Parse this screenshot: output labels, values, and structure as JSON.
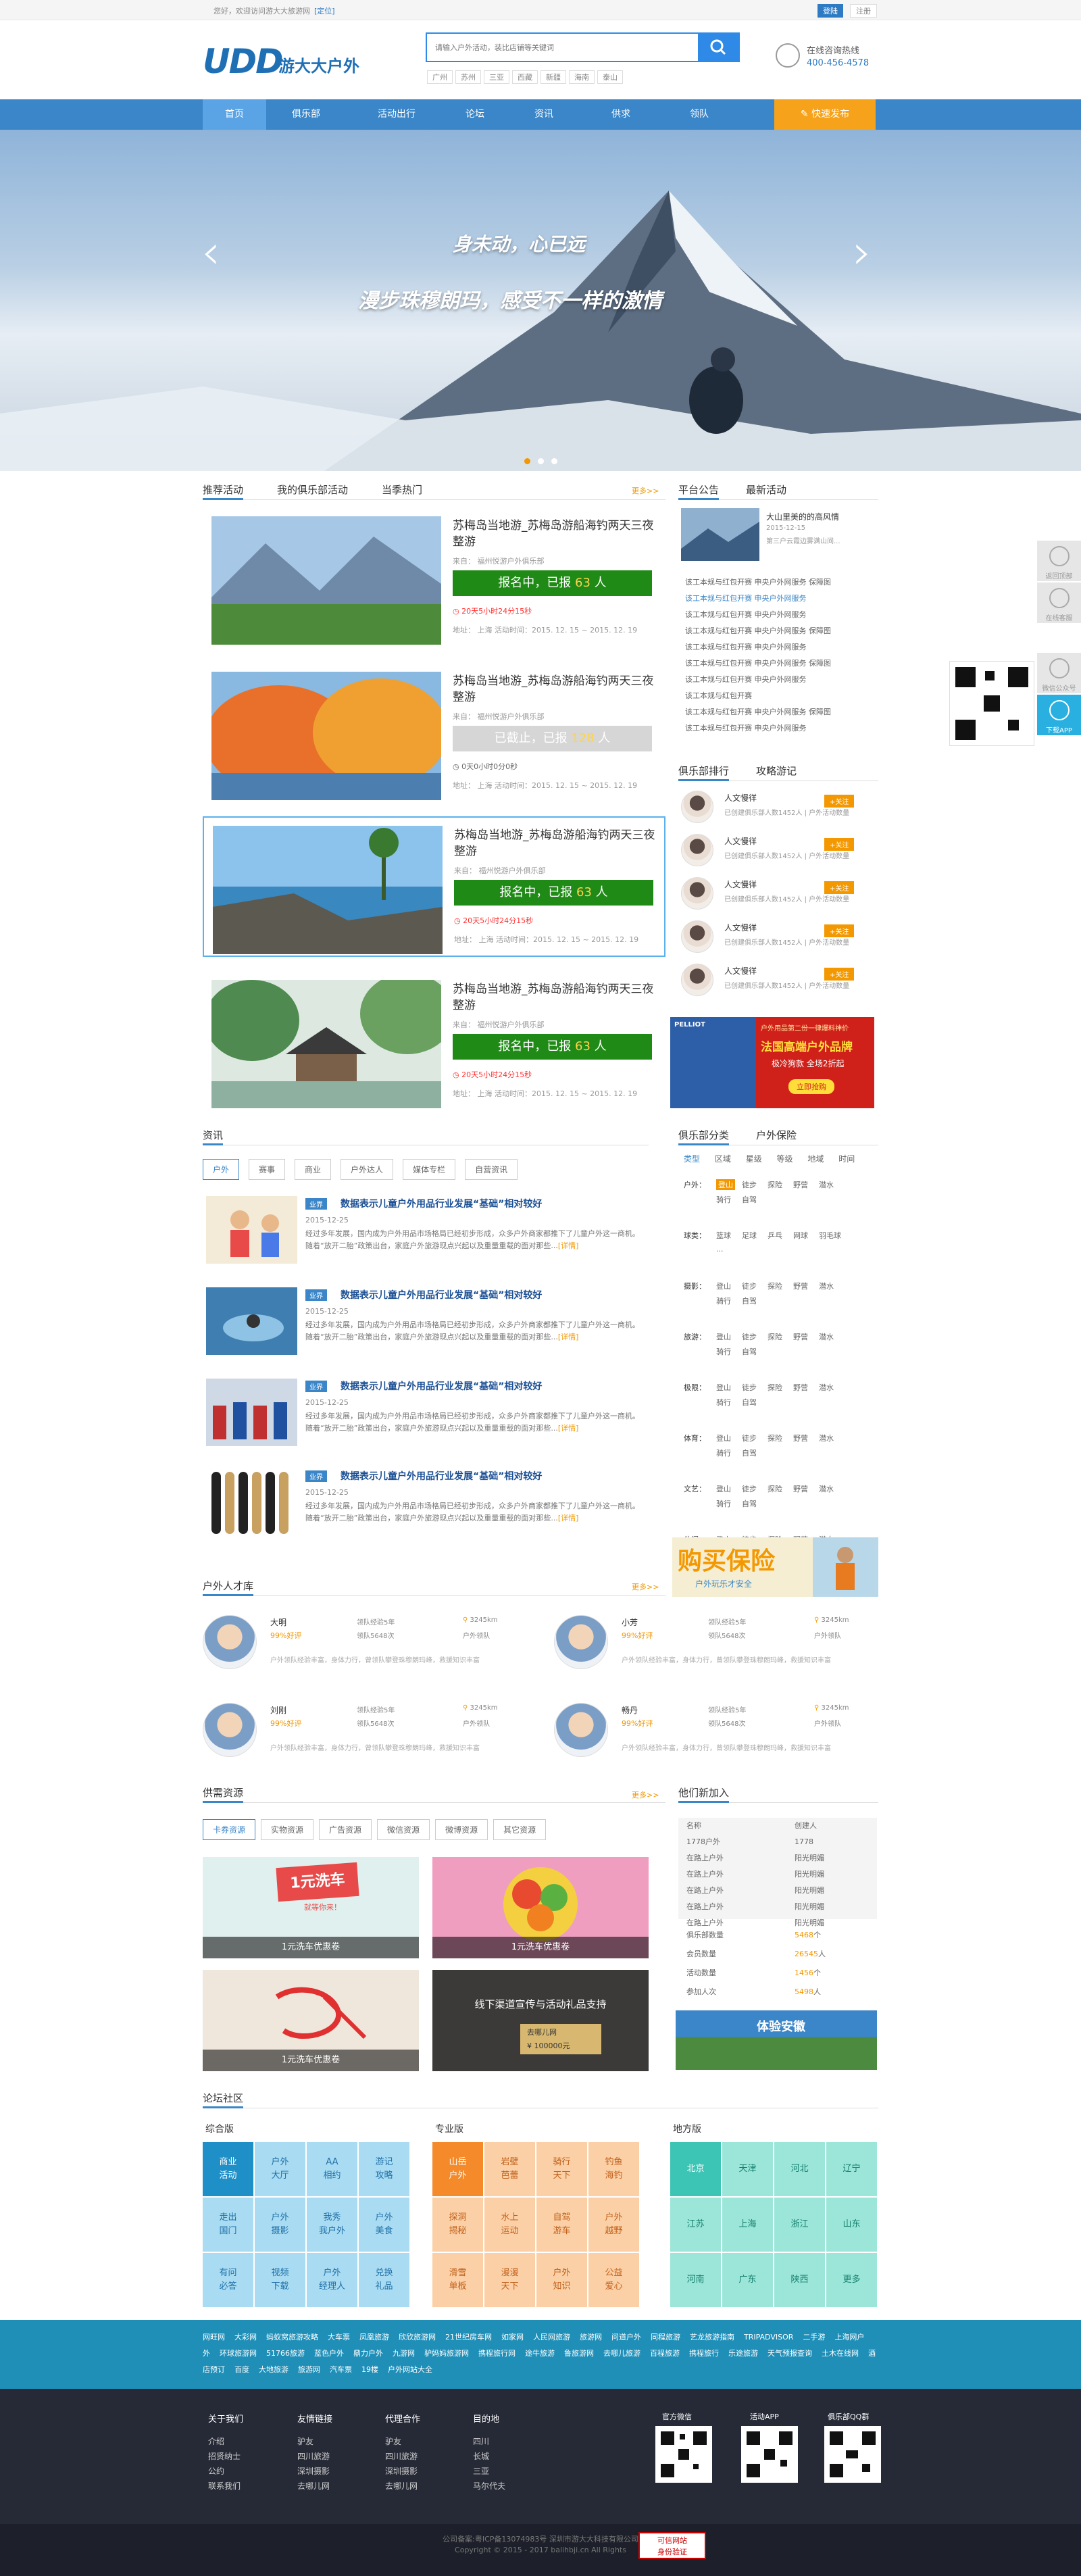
{
  "topbar": {
    "welcome": "您好，欢迎访问游大大旅游网",
    "city": "[定位]",
    "login": "登陆",
    "register": "注册"
  },
  "header": {
    "logo_mark": "UDD",
    "logo_cn": "游大大户外",
    "search_placeholder": "请输入户外活动，装比店铺等关键词",
    "hot": [
      "广州",
      "苏州",
      "三亚",
      "西藏",
      "新疆",
      "海南",
      "泰山"
    ],
    "phone_label": "在线咨询热线",
    "phone": "400-456-4578"
  },
  "nav": {
    "items": [
      "首页",
      "俱乐部",
      "活动出行",
      "论坛",
      "资讯",
      "供求",
      "领队"
    ],
    "fast": "快速发布"
  },
  "banner": {
    "line1": "身未动，心已远",
    "line2": "漫步珠穆朗玛，感受不一样的激情"
  },
  "activities": {
    "tabs": [
      "推荐活动",
      "我的俱乐部活动",
      "当季热门"
    ],
    "more": "更多>>",
    "items": [
      {
        "title": "苏梅岛当地游_苏梅岛游船海钓两天三夜整游",
        "meta": "来自：  福州悦游户外俱乐部",
        "status": "报名中，已报 63 人",
        "time": "20天5小时24分15秒",
        "addr": "地址：    上海         活动时间：2015. 12. 15 ~ 2015. 12. 19"
      },
      {
        "title": "苏梅岛当地游_苏梅岛游船海钓两天三夜整游",
        "meta": "来自：  福州悦游户外俱乐部",
        "status": "已截止，已报 128 人",
        "time": "0天0小时0分0秒",
        "addr": "地址：    上海         活动时间：2015. 12. 15 ~ 2015. 12. 19"
      },
      {
        "title": "苏梅岛当地游_苏梅岛游船海钓两天三夜整游",
        "meta": "来自：  福州悦游户外俱乐部",
        "status": "报名中，已报 63 人",
        "time": "20天5小时24分15秒",
        "addr": "地址：    上海         活动时间：2015. 12. 15 ~ 2015. 12. 19"
      },
      {
        "title": "苏梅岛当地游_苏梅岛游船海钓两天三夜整游",
        "meta": "来自：  福州悦游户外俱乐部",
        "status": "报名中，已报 63 人",
        "time": "20天5小时24分15秒",
        "addr": "地址：    上海         活动时间：2015. 12. 15 ~ 2015. 12. 19"
      }
    ]
  },
  "notice": {
    "tabs": [
      "平台公告",
      "最新活动"
    ],
    "top_title": "大山里美的的高风情",
    "top_date": "2015-12-15",
    "top_desc": "第三户云霞边雾满山间...",
    "list": [
      "该工本规与红包开赛 申央户外网服务 保障图",
      "该工本规与红包开赛 申央户外网服务",
      "该工本规与红包开赛 申央户外网服务",
      "该工本规与红包开赛 申央户外网服务 保障图",
      "该工本规与红包开赛 申央户外网服务",
      "该工本规与红包开赛 申央户外网服务 保障图",
      "该工本规与红包开赛 申央户外网服务",
      "该工本规与红包开赛",
      "该工本规与红包开赛 申央户外网服务 保障图",
      "该工本规与红包开赛 申央户外网服务"
    ]
  },
  "club_rank": {
    "tabs": [
      "俱乐部排行",
      "攻略游记"
    ],
    "items": [
      {
        "name": "人文慢徉",
        "desc": "已创建俱乐部人数1452人 | 户外活动数量",
        "follow": "+关注"
      },
      {
        "name": "人文慢徉",
        "desc": "已创建俱乐部人数1452人 | 户外活动数量",
        "follow": "+关注"
      },
      {
        "name": "人文慢徉",
        "desc": "已创建俱乐部人数1452人 | 户外活动数量",
        "follow": "+关注"
      },
      {
        "name": "人文慢徉",
        "desc": "已创建俱乐部人数1452人 | 户外活动数量",
        "follow": "+关注"
      },
      {
        "name": "人文慢徉",
        "desc": "已创建俱乐部人数1452人 | 户外活动数量",
        "follow": "+关注"
      }
    ]
  },
  "ad1": {
    "brand": "PELLIOT",
    "line1": "户外用品第二份一律爆料神价",
    "line2": "法国高端户外品牌",
    "line3": "极冷狗款 全场2折起",
    "btn": "立即抢购"
  },
  "news": {
    "title": "资讯",
    "tabs": [
      "户外",
      "赛事",
      "商业",
      "户外达人",
      "媒体专栏",
      "自营资讯"
    ],
    "items": [
      {
        "tag": "业界",
        "title": "数据表示儿童户外用品行业发展“基础”相对较好",
        "date": "2015-12-25",
        "summary": "经过多年发展，国内成为户外用品市场格局已经初步形成，众多户外商家都推下了儿童户外这一商机。随着“放开二胎”政策出台，家庭户外旅游现点兴起以及重量重载的面对那些...",
        "more": "[详情]"
      },
      {
        "tag": "业界",
        "title": "数据表示儿童户外用品行业发展“基础”相对较好",
        "date": "2015-12-25",
        "summary": "经过多年发展，国内成为户外用品市场格局已经初步形成，众多户外商家都推下了儿童户外这一商机。随着“放开二胎”政策出台，家庭户外旅游现点兴起以及重量重载的面对那些...",
        "more": "[详情]"
      },
      {
        "tag": "业界",
        "title": "数据表示儿童户外用品行业发展“基础”相对较好",
        "date": "2015-12-25",
        "summary": "经过多年发展，国内成为户外用品市场格局已经初步形成，众多户外商家都推下了儿童户外这一商机。随着“放开二胎”政策出台，家庭户外旅游现点兴起以及重量重载的面对那些...",
        "more": "[详情]"
      },
      {
        "tag": "业界",
        "title": "数据表示儿童户外用品行业发展“基础”相对较好",
        "date": "2015-12-25",
        "summary": "经过多年发展，国内成为户外用品市场格局已经初步形成，众多户外商家都推下了儿童户外这一商机。随着“放开二胎”政策出台，家庭户外旅游现点兴起以及重量重载的面对那些...",
        "more": "[详情]"
      }
    ]
  },
  "club_cat": {
    "tabs": [
      "俱乐部分类",
      "户外保险"
    ],
    "filters": [
      "类型",
      "区域",
      "星级",
      "等级",
      "地域",
      "时间"
    ],
    "rows": [
      {
        "label": "户外：",
        "items": [
          "登山",
          "徒步",
          "探险",
          "野营",
          "潜水",
          "骑行",
          "自驾"
        ]
      },
      {
        "label": "球类：",
        "items": [
          "篮球",
          "足球",
          "乒乓",
          "网球",
          "羽毛球",
          "..."
        ]
      },
      {
        "label": "摄影：",
        "items": [
          "登山",
          "徒步",
          "探险",
          "野营",
          "潜水",
          "骑行",
          "自驾"
        ]
      },
      {
        "label": "旅游：",
        "items": [
          "登山",
          "徒步",
          "探险",
          "野营",
          "潜水",
          "骑行",
          "自驾"
        ]
      },
      {
        "label": "极限：",
        "items": [
          "登山",
          "徒步",
          "探险",
          "野营",
          "潜水",
          "骑行",
          "自驾"
        ]
      },
      {
        "label": "体育：",
        "items": [
          "登山",
          "徒步",
          "探险",
          "野营",
          "潜水",
          "骑行",
          "自驾"
        ]
      },
      {
        "label": "文艺：",
        "items": [
          "登山",
          "徒步",
          "探险",
          "野营",
          "潜水",
          "骑行",
          "自驾"
        ]
      },
      {
        "label": "休闲：",
        "items": [
          "登山",
          "徒步",
          "探险",
          "野营",
          "潜水"
        ]
      }
    ]
  },
  "ad2": {
    "big": "购买保险",
    "small": "户外玩乐才安全"
  },
  "talent": {
    "title": "户外人才库",
    "more": "更多>>",
    "items": [
      {
        "name": "大明",
        "rate": "99%好评",
        "exp": "领队经验5年",
        "count": "领队5648次",
        "km": "3245km",
        "type": "户外领队",
        "desc": "户外领队经验丰富，身体力行，曾领队攀登珠穆朗玛峰，救援知识丰富"
      },
      {
        "name": "小芳",
        "rate": "99%好评",
        "exp": "领队经验5年",
        "count": "领队5648次",
        "km": "3245km",
        "type": "户外领队",
        "desc": "户外领队经验丰富，身体力行，曾领队攀登珠穆朗玛峰，救援知识丰富"
      },
      {
        "name": "刘刚",
        "rate": "99%好评",
        "exp": "领队经验5年",
        "count": "领队5648次",
        "km": "3245km",
        "type": "户外领队",
        "desc": "户外领队经验丰富，身体力行，曾领队攀登珠穆朗玛峰，救援知识丰富"
      },
      {
        "name": "畅丹",
        "rate": "99%好评",
        "exp": "领队经验5年",
        "count": "领队5648次",
        "km": "3245km",
        "type": "户外领队",
        "desc": "户外领队经验丰富，身体力行，曾领队攀登珠穆朗玛峰，救援知识丰富"
      }
    ]
  },
  "supply": {
    "title": "供需资源",
    "more": "更多>>",
    "tabs": [
      "卡券资源",
      "实物资源",
      "广告资源",
      "微信资源",
      "微博资源",
      "其它资源"
    ],
    "items": [
      "1元洗车优惠卷",
      "1元洗车优惠卷",
      "1元洗车优惠卷",
      "线下渠道宣传与活动礼品支持"
    ],
    "promo1": "1元洗车",
    "promo1b": "就等你来！",
    "promo4b": "去哪儿网",
    "promo4c": "¥ 100000元"
  },
  "joined": {
    "title": "他们新加入",
    "head": [
      "名称",
      "创建人"
    ],
    "rows": [
      [
        "1778户外",
        "1778"
      ],
      [
        "在路上户外",
        "阳光明媚"
      ],
      [
        "在路上户外",
        "阳光明媚"
      ],
      [
        "在路上户外",
        "阳光明媚"
      ],
      [
        "在路上户外",
        "阳光明媚"
      ],
      [
        "在路上户外",
        "阳光明媚"
      ]
    ],
    "stats": [
      {
        "label": "俱乐部数量",
        "value": "5468",
        "unit": "个"
      },
      {
        "label": "会员数量",
        "value": "26545",
        "unit": "人"
      },
      {
        "label": "活动数量",
        "value": "1456",
        "unit": "个"
      },
      {
        "label": "参加人次",
        "value": "5498",
        "unit": "人"
      }
    ],
    "ad": "体验安徽"
  },
  "forum": {
    "title": "论坛社区",
    "groups": [
      {
        "title": "综合版",
        "cells": [
          "商业\n活动",
          "户外\n大厅",
          "AA\n相约",
          "游记\n攻略",
          "走出\n国门",
          "户外\n摄影",
          "我秀\n我户外",
          "户外\n美食",
          "有问\n必答",
          "视频\n下载",
          "户外\n经理人",
          "兑换\n礼品"
        ]
      },
      {
        "title": "专业版",
        "cells": [
          "山岳\n户外",
          "岩壁\n芭蕾",
          "骑行\n天下",
          "钓鱼\n海钓",
          "探洞\n揭秘",
          "水上\n运动",
          "自驾\n游车",
          "户外\n越野",
          "滑雪\n单板",
          "漫漫\n天下",
          "户外\n知识",
          "公益\n爱心"
        ]
      },
      {
        "title": "地方版",
        "cells": [
          "北京",
          "天津",
          "河北",
          "辽宁",
          "江苏",
          "上海",
          "浙江",
          "山东",
          "河南",
          "广东",
          "陕西",
          "更多"
        ]
      }
    ]
  },
  "links": [
    "网旺网",
    "大彩网",
    "蚂蚁窝旅游攻略",
    "大车票",
    "凤凰旅游",
    "欣欣旅游网",
    "21世纪房车网",
    "如家网",
    "人民网旅游",
    "旅游网",
    "问道户外",
    "同程旅游",
    "艺龙旅游指南",
    "TRIPADVISOR",
    "二手游",
    "上海网户外",
    "环球旅游网",
    "51766旅游",
    "蓝色户外",
    "鼎力户外",
    "九游网",
    "驴妈妈旅游网",
    "携程旅行网",
    "途牛旅游",
    "鲁旅游网",
    "去哪儿旅游",
    "百程旅游",
    "携程旅行",
    "乐途旅游",
    "天气预报查询",
    "土木在线网",
    "酒店预订",
    "百度",
    "大地旅游",
    "旅游网",
    "汽车票",
    "19楼",
    "户外网站大全"
  ],
  "footer": {
    "cols": [
      {
        "h": "关于我们",
        "items": [
          "介绍",
          "招贤纳士",
          "公约",
          "联系我们"
        ]
      },
      {
        "h": "友情链接",
        "items": [
          "驴友",
          "四川旅游",
          "深圳摄影",
          "去哪儿网"
        ]
      },
      {
        "h": "代理合作",
        "items": [
          "驴友",
          "四川旅游",
          "深圳摄影",
          "去哪儿网"
        ]
      },
      {
        "h": "目的地",
        "items": [
          "四川",
          "长城",
          "三亚",
          "马尔代夫"
        ]
      }
    ],
    "qr": [
      "官方微信",
      "活动APP",
      "俱乐部QQ群"
    ],
    "copy1": "公司备案:粤ICP备13074983号    深圳市游大大科技有限公司",
    "copy2": "Copyright © 2015 - 2017 balihbji.cn  All Rights",
    "badge": "可信网站\n身份验证"
  },
  "side": [
    "返回顶部",
    "在线客服",
    "微信公众号",
    "下载APP"
  ]
}
